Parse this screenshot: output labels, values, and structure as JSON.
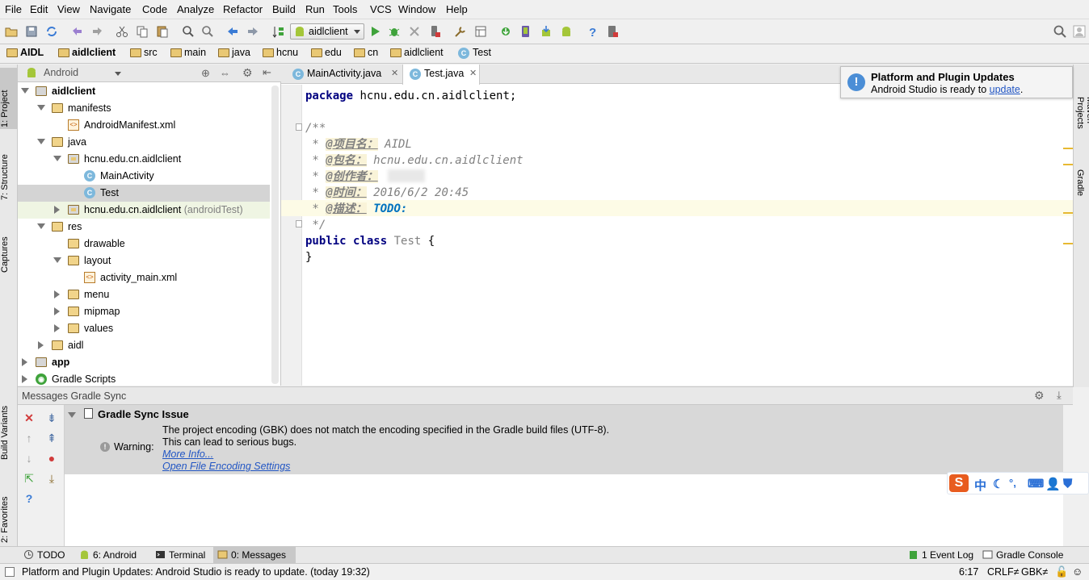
{
  "menu": [
    "File",
    "Edit",
    "View",
    "Navigate",
    "Code",
    "Analyze",
    "Refactor",
    "Build",
    "Run",
    "Tools",
    "VCS",
    "Window",
    "Help"
  ],
  "toolbar": {
    "run_config": "aidlclient"
  },
  "breadcrumb": [
    "AIDL",
    "aidlclient",
    "src",
    "main",
    "java",
    "hcnu",
    "edu",
    "cn",
    "aidlclient",
    "Test"
  ],
  "left_strip": {
    "project": "1: Project",
    "structure": "7: Structure",
    "captures": "Captures",
    "build_variants": "Build Variants",
    "favorites": "2: Favorites"
  },
  "right_strip": {
    "maven": "Maven Projects",
    "gradle": "Gradle"
  },
  "project_panel": {
    "view_mode": "Android",
    "tree": [
      {
        "label": "aidlclient",
        "level": 0,
        "icon": "module",
        "expanded": true,
        "bold": true
      },
      {
        "label": "manifests",
        "level": 1,
        "icon": "folder",
        "expanded": true
      },
      {
        "label": "AndroidManifest.xml",
        "level": 2,
        "icon": "xml"
      },
      {
        "label": "java",
        "level": 1,
        "icon": "folder",
        "expanded": true
      },
      {
        "label": "hcnu.edu.cn.aidlclient",
        "level": 2,
        "icon": "package",
        "expanded": true
      },
      {
        "label": "MainActivity",
        "level": 3,
        "icon": "class"
      },
      {
        "label": "Test",
        "level": 3,
        "icon": "class",
        "selected": true
      },
      {
        "label": "hcnu.edu.cn.aidlclient",
        "suffix": "(androidTest)",
        "level": 2,
        "icon": "package",
        "expanded": false,
        "highlight": true
      },
      {
        "label": "res",
        "level": 1,
        "icon": "folder",
        "expanded": true
      },
      {
        "label": "drawable",
        "level": 2,
        "icon": "folder"
      },
      {
        "label": "layout",
        "level": 2,
        "icon": "folder",
        "expanded": true
      },
      {
        "label": "activity_main.xml",
        "level": 3,
        "icon": "xml"
      },
      {
        "label": "menu",
        "level": 2,
        "icon": "folder",
        "expanded": false
      },
      {
        "label": "mipmap",
        "level": 2,
        "icon": "folder",
        "expanded": false
      },
      {
        "label": "values",
        "level": 2,
        "icon": "folder",
        "expanded": false
      },
      {
        "label": "aidl",
        "level": 1,
        "icon": "folder",
        "expanded": false
      },
      {
        "label": "app",
        "level": 0,
        "icon": "module",
        "expanded": false,
        "bold": true
      },
      {
        "label": "Gradle Scripts",
        "level": 0,
        "icon": "gradle",
        "expanded": false
      }
    ]
  },
  "editor": {
    "tabs": [
      {
        "label": "MainActivity.java",
        "active": false
      },
      {
        "label": "Test.java",
        "active": true
      }
    ],
    "code": {
      "package_kw": "package",
      "package_name": " hcnu.edu.cn.aidlclient;",
      "doc_open": "/**",
      "star": " * ",
      "tag_project": "@项目名：",
      "val_project": " AIDL",
      "tag_package": "@包名：",
      "val_package": " hcnu.edu.cn.aidlclient",
      "tag_author": "@创作者：",
      "tag_time": "@时间：",
      "val_time": " 2016/6/2 20:45",
      "tag_desc": "@描述：",
      "val_desc": " TODO:",
      "doc_close": " */",
      "public_kw": "public",
      "class_kw": "class",
      "class_name": "Test",
      "open_brace": " {",
      "close_brace": "}"
    }
  },
  "notification": {
    "title": "Platform and Plugin Updates",
    "text": "Android Studio is ready to ",
    "link": "update",
    "end": "."
  },
  "messages": {
    "header": "Messages Gradle Sync",
    "group": "Gradle Sync Issue",
    "warning_label": "Warning:",
    "line1": "The project encoding (GBK) does not match the encoding specified in the Gradle build files (UTF-8).",
    "line2": "This can lead to serious bugs.",
    "link1": "More Info...",
    "link2": "Open File Encoding Settings"
  },
  "bottom_tabs": [
    {
      "label": "TODO",
      "active": false
    },
    {
      "label": "6: Android",
      "active": false
    },
    {
      "label": "Terminal",
      "active": false
    },
    {
      "label": "0: Messages",
      "active": true
    }
  ],
  "bottom_right_tabs": [
    {
      "label": "1 Event Log"
    },
    {
      "label": "Gradle Console"
    }
  ],
  "status": {
    "message": "Platform and Plugin Updates: Android Studio is ready to update. (today 19:32)",
    "position": "6:17",
    "line_sep": "CRLF≠",
    "encoding": "GBK≠"
  },
  "ime": {
    "lang": "中"
  },
  "colors": {
    "accent": "#2256c4",
    "keyword": "#000080",
    "todo": "#0073bf",
    "android_green": "#a4c639",
    "run_green": "#3fa33b"
  }
}
